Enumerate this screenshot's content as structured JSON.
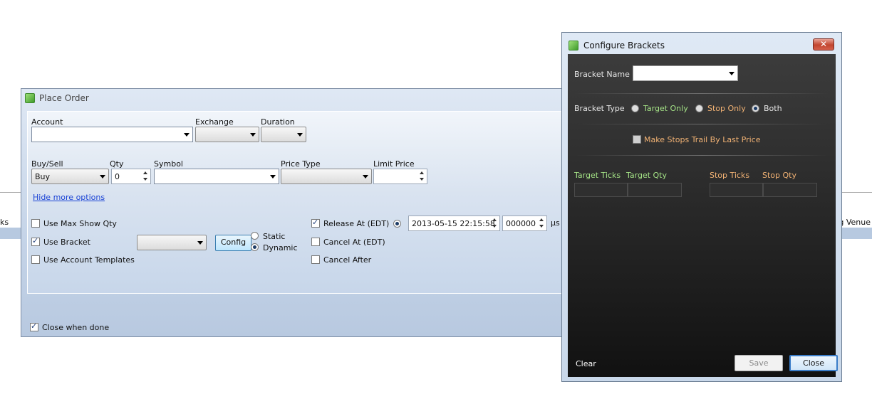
{
  "background": {
    "left_text": "ks",
    "right_text": "ng Venue"
  },
  "place_order": {
    "title": "Place Order",
    "account_label": "Account",
    "account_value": "",
    "exchange_label": "Exchange",
    "exchange_value": "",
    "duration_label": "Duration",
    "duration_value": "",
    "buy_sell_label": "Buy/Sell",
    "buy_sell_value": "Buy",
    "qty_label": "Qty",
    "qty_value": "0",
    "symbol_label": "Symbol",
    "symbol_value": "",
    "price_type_label": "Price Type",
    "price_type_value": "",
    "limit_price_label": "Limit Price",
    "limit_price_value": "",
    "hide_more_options": "Hide more options",
    "use_max_show_qty": "Use Max Show Qty",
    "use_bracket": "Use Bracket",
    "use_account_templates": "Use Account Templates",
    "bracket_value": "",
    "config_button": "Config",
    "static_label": "Static",
    "dynamic_label": "Dynamic",
    "release_at": "Release At (EDT)",
    "cancel_at": "Cancel At (EDT)",
    "cancel_after": "Cancel After",
    "release_datetime": "2013-05-15 22:15:58",
    "release_micro": "000000",
    "micro_unit": "µs",
    "close_when_done": "Close when done",
    "checked": {
      "use_max_show_qty": false,
      "use_bracket": true,
      "use_account_templates": false,
      "release_at": true,
      "cancel_at": false,
      "cancel_after": false,
      "close_when_done": true
    }
  },
  "configure_brackets": {
    "title": "Configure Brackets",
    "close_x": "✕",
    "bracket_name_label": "Bracket Name",
    "bracket_name_value": "",
    "bracket_type_label": "Bracket Type",
    "type_target_only": "Target Only",
    "type_stop_only": "Stop Only",
    "type_both": "Both",
    "selected_type": "Both",
    "trail_label": "Make Stops Trail By Last Price",
    "trail_checked": false,
    "columns": {
      "target_ticks": "Target Ticks",
      "target_qty": "Target Qty",
      "stop_ticks": "Stop Ticks",
      "stop_qty": "Stop Qty"
    },
    "clear": "Clear",
    "save": "Save",
    "close": "Close"
  },
  "colors": {
    "target_green": "#a4e286",
    "stop_orange": "#f1b274",
    "dialog_dark": "#2c2c2c"
  }
}
